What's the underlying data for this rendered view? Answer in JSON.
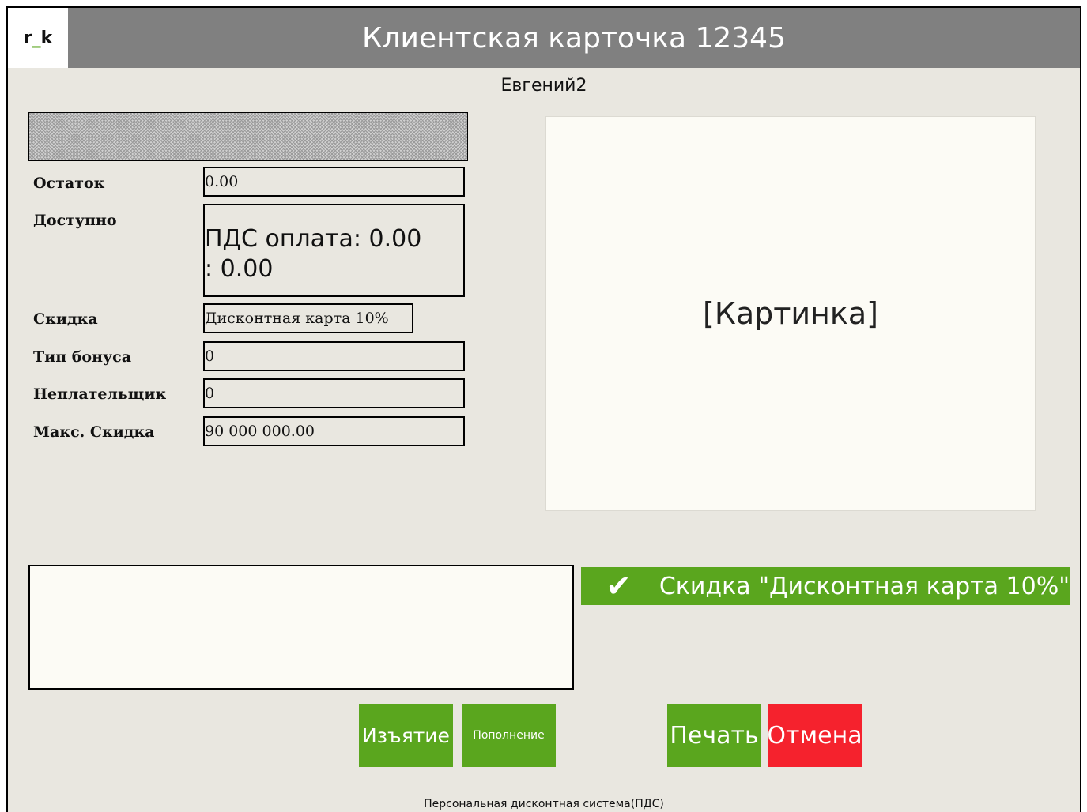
{
  "header": {
    "logo": {
      "prefix": "r",
      "underscore": "_",
      "suffix": "k"
    },
    "title": "Клиентская карточка 12345"
  },
  "client": {
    "name": "Евгений2"
  },
  "fields": [
    {
      "label": "Остаток",
      "value": "0.00"
    },
    {
      "label": "Доступно",
      "value_line1": "ПДС оплата: 0.00",
      "value_line2": ": 0.00"
    },
    {
      "label": "Скидка",
      "value": "Дисконтная карта 10%"
    },
    {
      "label": "Тип бонуса",
      "value": "0"
    },
    {
      "label": "Неплательщик",
      "value": "0"
    },
    {
      "label": "Макс. Скидка",
      "value": "90 000 000.00"
    }
  ],
  "picture": {
    "placeholder": "[Картинка]"
  },
  "discount_status": {
    "icon": "check-icon",
    "text": "Скидка \"Дисконтная карта 10%\""
  },
  "buttons": {
    "withdraw": "Изъятие",
    "topup": "Пополнение",
    "print": "Печать",
    "cancel": "Отмена"
  },
  "footer": {
    "text": "Персональная дисконтная система(ПДС)"
  },
  "colors": {
    "header_bg": "#808080",
    "panel_bg": "#e9e7e0",
    "green": "#5aa61e",
    "red": "#f5222d"
  }
}
